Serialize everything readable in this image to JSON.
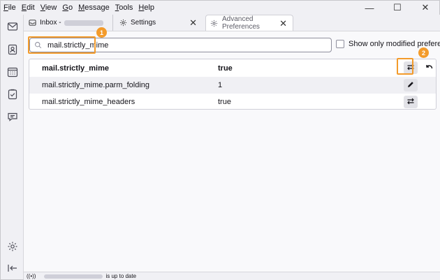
{
  "menubar": {
    "items": [
      {
        "label": "File",
        "key": "F",
        "rest": "ile"
      },
      {
        "label": "Edit",
        "key": "E",
        "rest": "dit"
      },
      {
        "label": "View",
        "key": "V",
        "rest": "iew"
      },
      {
        "label": "Go",
        "key": "G",
        "rest": "o"
      },
      {
        "label": "Message",
        "key": "M",
        "rest": "essage"
      },
      {
        "label": "Tools",
        "key": "T",
        "rest": "ools"
      },
      {
        "label": "Help",
        "key": "H",
        "rest": "elp"
      }
    ],
    "minimize": "—",
    "maximize": "☐",
    "close": "✕"
  },
  "tabs": {
    "inbox_label": "Inbox -",
    "settings_label": "Settings",
    "advanced_label": "Advanced Preferences",
    "close_glyph": "✕"
  },
  "search": {
    "value": "mail.strictly_mime",
    "badge": "1"
  },
  "modified_only": {
    "label": "Show only modified preferences",
    "checked": false
  },
  "preferences": {
    "rows": [
      {
        "name": "mail.strictly_mime",
        "value": "true",
        "action": "toggle"
      },
      {
        "name": "mail.strictly_mime.parm_folding",
        "value": "1",
        "action": "edit"
      },
      {
        "name": "mail.strictly_mime_headers",
        "value": "true",
        "action": "toggle"
      }
    ],
    "badge": "2"
  },
  "status": {
    "text": "is up to date",
    "wifi": "((•))"
  },
  "colors": {
    "highlight": "#f39b2b",
    "background": "#f0f0f4",
    "content": "#f9f9fb"
  }
}
